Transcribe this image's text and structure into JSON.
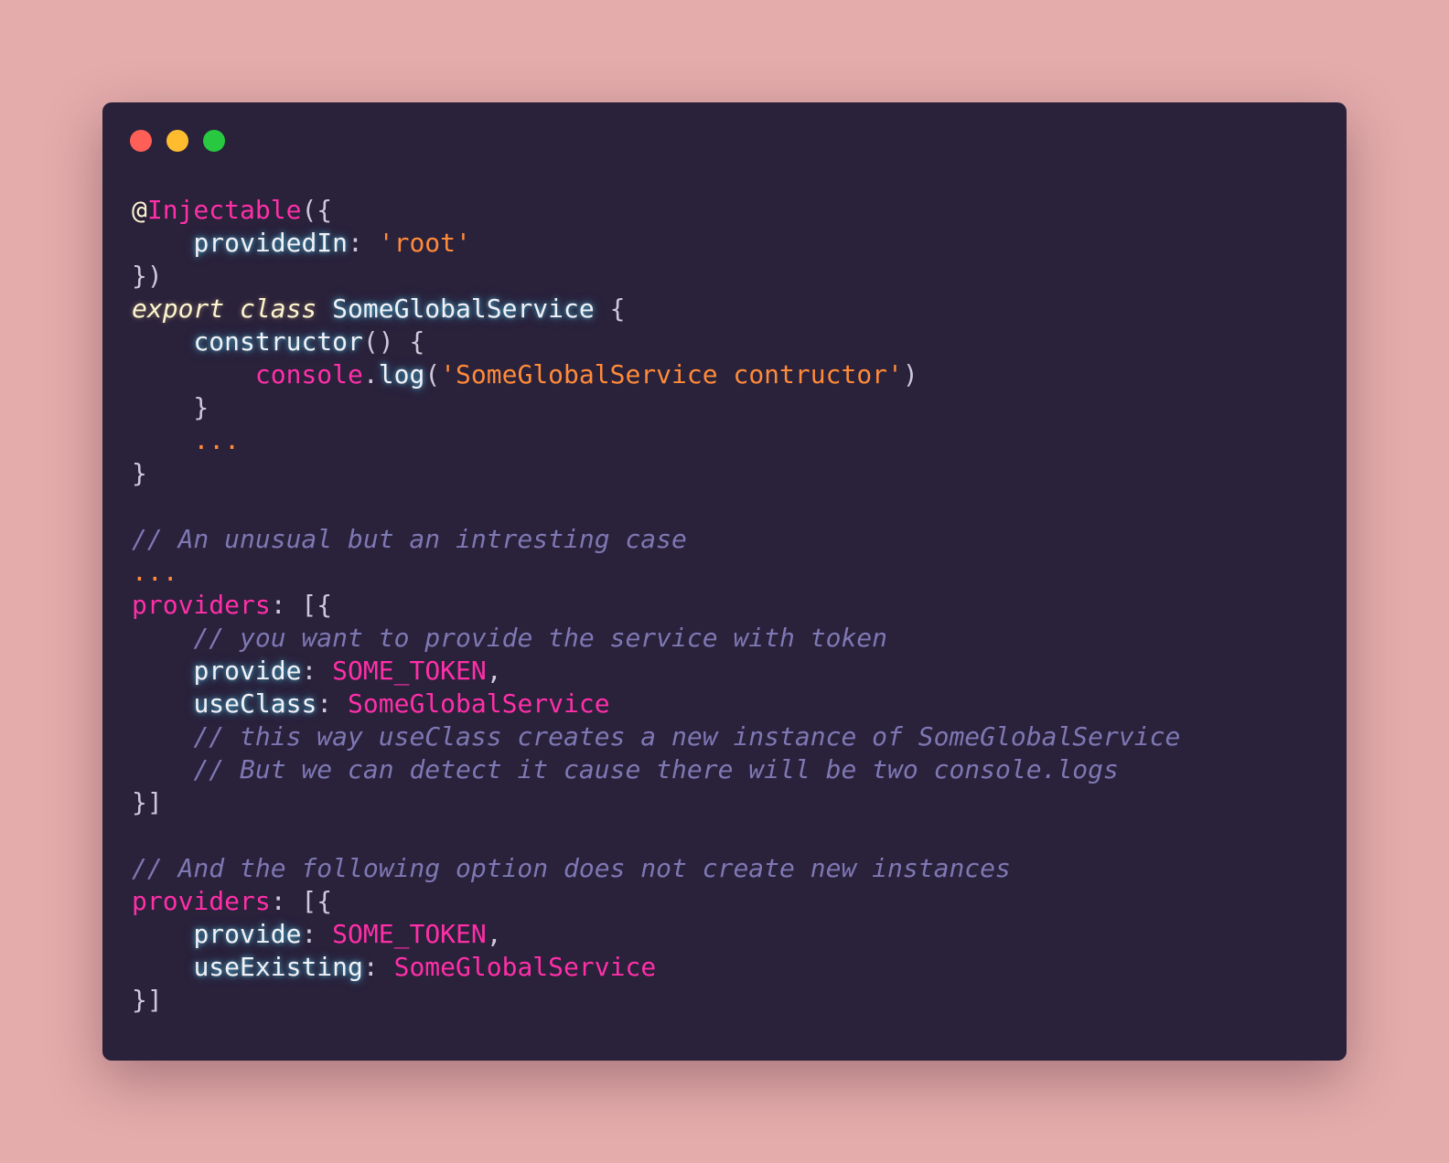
{
  "window": {
    "controls": [
      {
        "name": "close",
        "color": "#ff5f57"
      },
      {
        "name": "minimize",
        "color": "#febc2e"
      },
      {
        "name": "maximize",
        "color": "#28c840"
      }
    ]
  },
  "colors": {
    "background": "#e4acab",
    "window": "#2a213b",
    "identifier": "#f3f0f6",
    "key": "#ff2fa8",
    "string": "#ff8b39",
    "comment": "#7e78b3",
    "keyword": "#fef5cf",
    "punctuation": "#cfc7db"
  },
  "code": {
    "lines": [
      [
        {
          "t": "at",
          "v": "@"
        },
        {
          "t": "key",
          "v": "Injectable"
        },
        {
          "t": "plain",
          "v": "({"
        }
      ],
      [
        {
          "t": "plain",
          "v": "    "
        },
        {
          "t": "ident",
          "v": "providedIn"
        },
        {
          "t": "plain",
          "v": ": "
        },
        {
          "t": "str",
          "v": "'root'"
        }
      ],
      [
        {
          "t": "plain",
          "v": "})"
        }
      ],
      [
        {
          "t": "keyword",
          "v": "export class"
        },
        {
          "t": "plain",
          "v": " "
        },
        {
          "t": "ident",
          "v": "SomeGlobalService"
        },
        {
          "t": "plain",
          "v": " {"
        }
      ],
      [
        {
          "t": "plain",
          "v": "    "
        },
        {
          "t": "ident",
          "v": "constructor"
        },
        {
          "t": "plain",
          "v": "() {"
        }
      ],
      [
        {
          "t": "plain",
          "v": "        "
        },
        {
          "t": "key",
          "v": "console"
        },
        {
          "t": "plain",
          "v": "."
        },
        {
          "t": "ident",
          "v": "log"
        },
        {
          "t": "plain",
          "v": "("
        },
        {
          "t": "str",
          "v": "'SomeGlobalService contructor'"
        },
        {
          "t": "plain",
          "v": ")"
        }
      ],
      [
        {
          "t": "plain",
          "v": "    }"
        }
      ],
      [
        {
          "t": "plain",
          "v": "    "
        },
        {
          "t": "str",
          "v": "..."
        }
      ],
      [
        {
          "t": "plain",
          "v": "}"
        }
      ],
      [],
      [
        {
          "t": "comment",
          "v": "// An unusual but an intresting case"
        }
      ],
      [
        {
          "t": "str",
          "v": "..."
        }
      ],
      [
        {
          "t": "key",
          "v": "providers"
        },
        {
          "t": "plain",
          "v": ": [{"
        }
      ],
      [
        {
          "t": "plain",
          "v": "    "
        },
        {
          "t": "comment",
          "v": "// you want to provide the service with token"
        }
      ],
      [
        {
          "t": "plain",
          "v": "    "
        },
        {
          "t": "ident",
          "v": "provide"
        },
        {
          "t": "plain",
          "v": ": "
        },
        {
          "t": "key",
          "v": "SOME_TOKEN"
        },
        {
          "t": "plain",
          "v": ","
        }
      ],
      [
        {
          "t": "plain",
          "v": "    "
        },
        {
          "t": "ident",
          "v": "useClass"
        },
        {
          "t": "plain",
          "v": ": "
        },
        {
          "t": "key",
          "v": "SomeGlobalService"
        }
      ],
      [
        {
          "t": "plain",
          "v": "    "
        },
        {
          "t": "comment",
          "v": "// this way useClass creates a new instance of SomeGlobalService"
        }
      ],
      [
        {
          "t": "plain",
          "v": "    "
        },
        {
          "t": "comment",
          "v": "// But we can detect it cause there will be two console.logs"
        }
      ],
      [
        {
          "t": "plain",
          "v": "}]"
        }
      ],
      [],
      [
        {
          "t": "comment",
          "v": "// And the following option does not create new instances"
        }
      ],
      [
        {
          "t": "key",
          "v": "providers"
        },
        {
          "t": "plain",
          "v": ": [{"
        }
      ],
      [
        {
          "t": "plain",
          "v": "    "
        },
        {
          "t": "ident",
          "v": "provide"
        },
        {
          "t": "plain",
          "v": ": "
        },
        {
          "t": "key",
          "v": "SOME_TOKEN"
        },
        {
          "t": "plain",
          "v": ","
        }
      ],
      [
        {
          "t": "plain",
          "v": "    "
        },
        {
          "t": "ident",
          "v": "useExisting"
        },
        {
          "t": "plain",
          "v": ": "
        },
        {
          "t": "key",
          "v": "SomeGlobalService"
        }
      ],
      [
        {
          "t": "plain",
          "v": "}]"
        }
      ]
    ]
  }
}
